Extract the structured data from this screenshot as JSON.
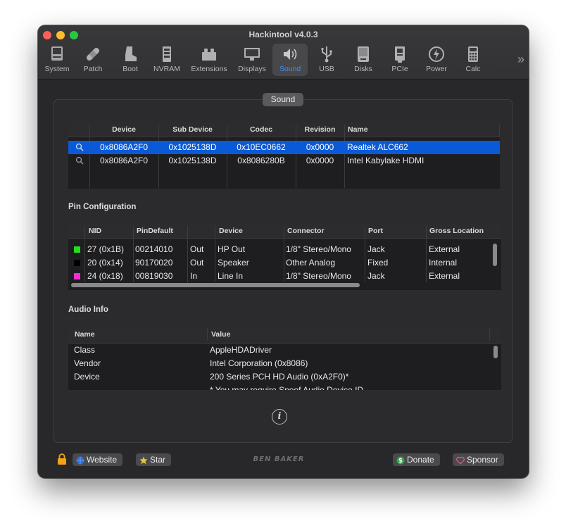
{
  "window": {
    "title": "Hackintool v4.0.3"
  },
  "toolbar": {
    "items": [
      {
        "label": "System",
        "icon": "system-icon"
      },
      {
        "label": "Patch",
        "icon": "bandage-icon"
      },
      {
        "label": "Boot",
        "icon": "boot-icon"
      },
      {
        "label": "NVRAM",
        "icon": "memory-icon"
      },
      {
        "label": "Extensions",
        "icon": "lego-icon"
      },
      {
        "label": "Displays",
        "icon": "monitor-icon"
      },
      {
        "label": "Sound",
        "icon": "speaker-icon",
        "active": true
      },
      {
        "label": "USB",
        "icon": "usb-icon"
      },
      {
        "label": "Disks",
        "icon": "disk-icon"
      },
      {
        "label": "PCIe",
        "icon": "pcie-icon"
      },
      {
        "label": "Power",
        "icon": "power-icon"
      },
      {
        "label": "Calc",
        "icon": "calculator-icon"
      }
    ],
    "more": "»"
  },
  "panel_tab": "Sound",
  "devices": {
    "columns": [
      "Device",
      "Sub Device",
      "Codec",
      "Revision",
      "Name"
    ],
    "rows": [
      {
        "device": "0x8086A2F0",
        "sub_device": "0x1025138D",
        "codec": "0x10EC0662",
        "revision": "0x0000",
        "name": "Realtek ALC662",
        "selected": true
      },
      {
        "device": "0x8086A2F0",
        "sub_device": "0x1025138D",
        "codec": "0x8086280B",
        "revision": "0x0000",
        "name": "Intel Kabylake HDMI",
        "selected": false
      }
    ]
  },
  "pin_config": {
    "title": "Pin Configuration",
    "columns": [
      "NID",
      "PinDefault",
      "",
      "Device",
      "Connector",
      "Port",
      "Gross Location"
    ],
    "rows": [
      {
        "color": "#22dd22",
        "nid": "27 (0x1B)",
        "pin_default": "00214010",
        "dir": "Out",
        "device": "HP Out",
        "connector": "1/8\" Stereo/Mono",
        "port": "Jack",
        "location": "External"
      },
      {
        "color": "#000000",
        "nid": "20 (0x14)",
        "pin_default": "90170020",
        "dir": "Out",
        "device": "Speaker",
        "connector": "Other Analog",
        "port": "Fixed",
        "location": "Internal"
      },
      {
        "color": "#ff2bd6",
        "nid": "24 (0x18)",
        "pin_default": "00819030",
        "dir": "In",
        "device": "Line In",
        "connector": "1/8\" Stereo/Mono",
        "port": "Jack",
        "location": "External"
      }
    ]
  },
  "audio_info": {
    "title": "Audio Info",
    "columns": [
      "Name",
      "Value"
    ],
    "rows": [
      {
        "name": "Class",
        "value": "AppleHDADriver"
      },
      {
        "name": "Vendor",
        "value": "Intel Corporation (0x8086)"
      },
      {
        "name": "Device",
        "value": "200 Series PCH HD Audio (0xA2F0)*"
      },
      {
        "name": "",
        "value": "* You may require Spoof Audio Device ID"
      }
    ]
  },
  "footer": {
    "website": "Website",
    "star": "Star",
    "brand": "BEN BAKER",
    "donate": "Donate",
    "sponsor": "Sponsor"
  },
  "colors": {
    "accent": "#0a5ad8",
    "active_label": "#3d8ef5",
    "window_bg": "#28282a"
  }
}
